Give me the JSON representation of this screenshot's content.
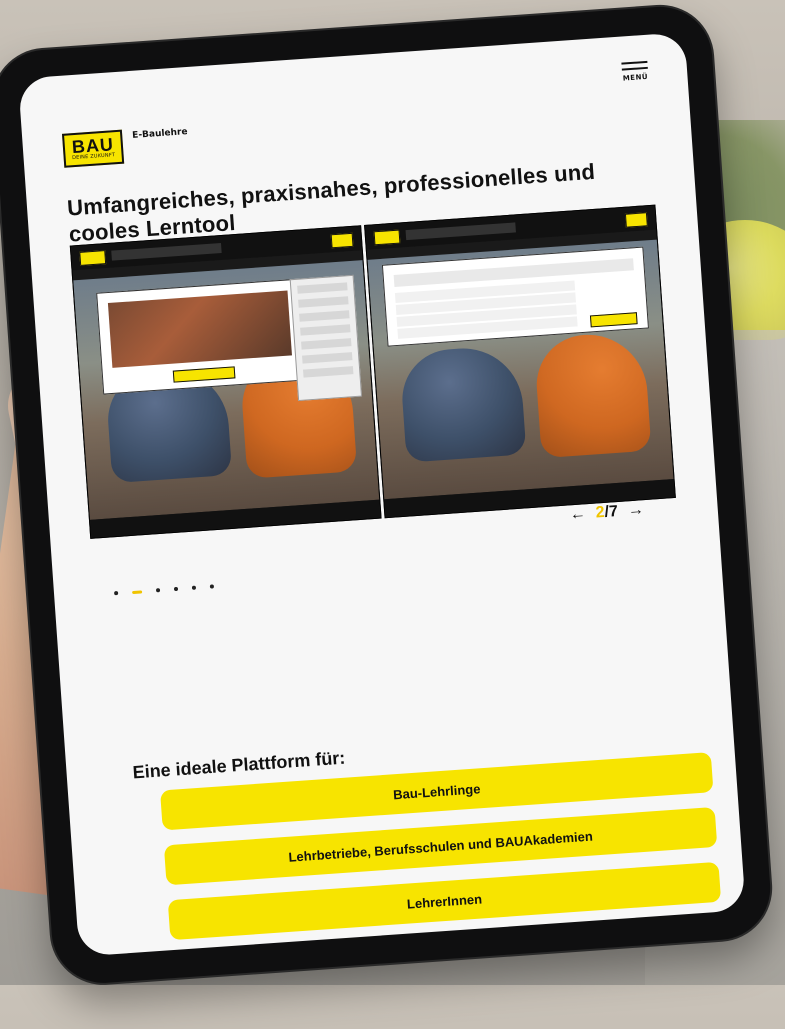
{
  "ui": {
    "menu_label": "MENÜ",
    "brand": {
      "logo_text_big": "BAU",
      "logo_text_small": "DEINE ZUKUNFT",
      "name": "E-Baulehre"
    },
    "headline": "Umfangreiches, praxisnahes, professionelles und cooles Lerntool",
    "pagination": {
      "prev_symbol": "←",
      "current": "2",
      "total": "7",
      "next_symbol": "→"
    },
    "carousel": {
      "dots": [
        "",
        "",
        "",
        "",
        "",
        ""
      ],
      "active_index": 1
    },
    "platform": {
      "title": "Eine ideale Plattform für:",
      "items": [
        "Bau-Lehrlinge",
        "Lehrbetriebe, Berufsschulen und BAUAkademien",
        "LehrerInnen"
      ]
    }
  }
}
